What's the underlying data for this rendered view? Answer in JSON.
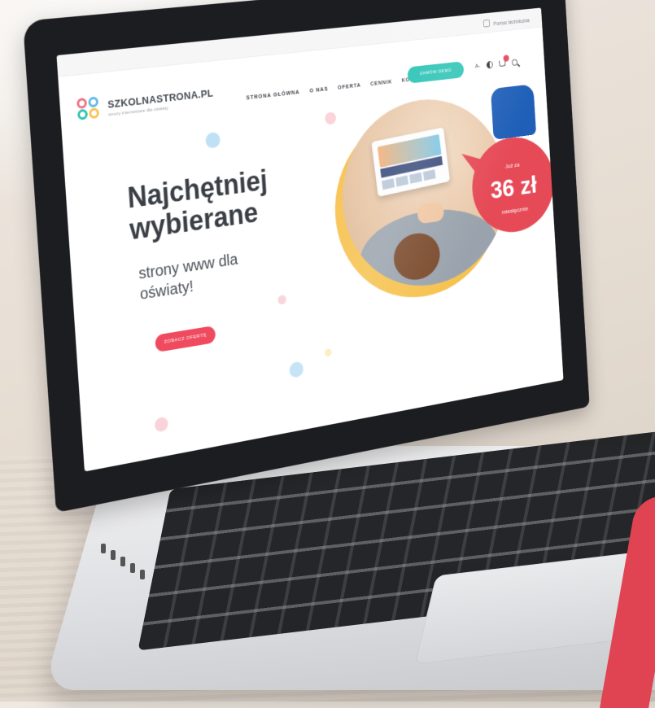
{
  "site": {
    "brand": "SZKOLNASTRONA.PL",
    "brand_tagline": "strony internetowe dla oświaty",
    "topbar_contact": "Pomoc techniczna"
  },
  "nav": {
    "items": [
      "STRONA GŁÓWNA",
      "O NAS",
      "OFERTA",
      "CENNIK",
      "KONTAKT"
    ],
    "cta_label": "ZAMÓW DEMO"
  },
  "hero": {
    "title_line1": "Najchętniej",
    "title_line2": "wybierane",
    "subtitle": "strony www dla oświaty!",
    "button_label": "ZOBACZ OFERTĘ"
  },
  "price_badge": {
    "top": "Już za",
    "amount": "36 zł",
    "bottom": "miesięcznie"
  },
  "colors": {
    "accent_teal": "#27c2b4",
    "accent_red": "#e64a57",
    "ring_yellow": "#f6c24f"
  },
  "icons": [
    "phone-icon",
    "text-size-icon",
    "contrast-icon",
    "cart-icon",
    "search-icon"
  ]
}
